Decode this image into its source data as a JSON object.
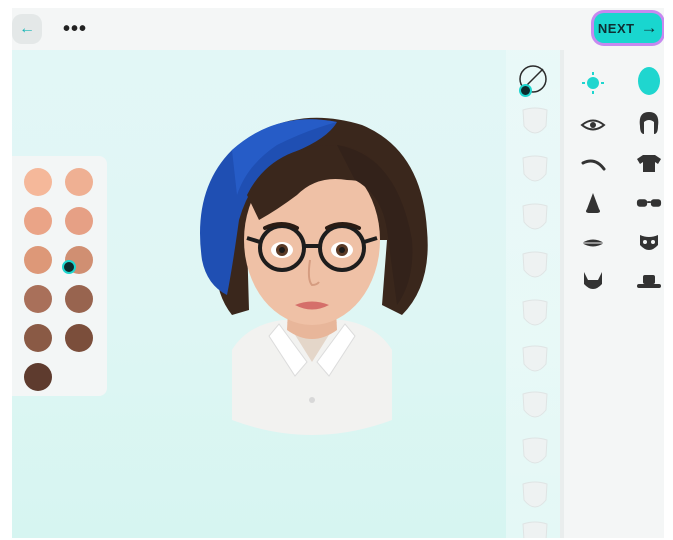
{
  "topbar": {
    "back_icon": "back-arrow-icon",
    "more_label": "•••",
    "next_label": "NEXT",
    "next_icon": "arrow-right-icon",
    "accent": "#19d6cf",
    "next_outline": "#c689f0"
  },
  "skin_palette": {
    "selected_index": 5,
    "colors": [
      "#f5b89a",
      "#efb093",
      "#eaa487",
      "#e6a085",
      "#dd9878",
      "#d08f72",
      "#a9705a",
      "#98644f",
      "#8a5a45",
      "#7b4e3b",
      "#5e3b2e"
    ]
  },
  "shape_options": {
    "none_icon": "no-selection-icon",
    "face_icon": "face-shape-icon",
    "count": 11
  },
  "categories": {
    "left_column": [
      "face-shape-icon",
      "eye-icon",
      "eyebrow-icon",
      "nose-icon",
      "lips-icon",
      "beard-icon"
    ],
    "right_column": [
      "head-icon",
      "hair-icon",
      "shirt-icon",
      "glasses-icon",
      "mask-icon",
      "hat-icon"
    ],
    "active": "face-shape-icon"
  }
}
